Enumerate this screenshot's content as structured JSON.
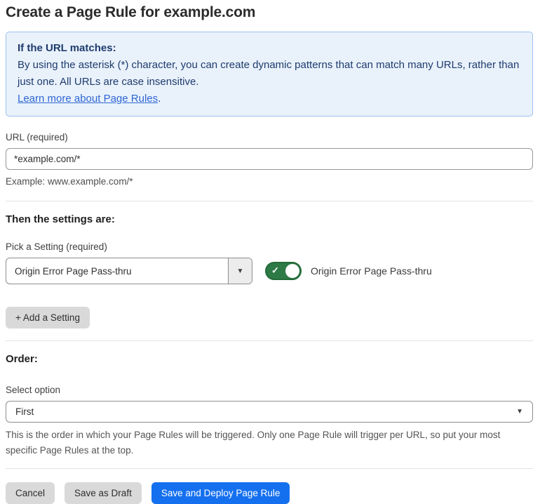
{
  "page": {
    "title": "Create a Page Rule for example.com"
  },
  "callout": {
    "heading": "If the URL matches:",
    "body": "By using the asterisk (*) character, you can create dynamic patterns that can match many URLs, rather than just one. All URLs are case insensitive.",
    "link_label": "Learn more about Page Rules",
    "link_suffix": "."
  },
  "url_section": {
    "label": "URL (required)",
    "input_value": "*example.com/*",
    "helper": "Example: www.example.com/*"
  },
  "settings_section": {
    "heading": "Then the settings are:",
    "picker_label": "Pick a Setting (required)",
    "picker_value": "Origin Error Page Pass-thru",
    "toggle_state": "on",
    "toggle_check": "✓",
    "toggle_label": "Origin Error Page Pass-thru",
    "add_button_label": "+ Add a Setting"
  },
  "order_section": {
    "heading": "Order:",
    "select_label": "Select option",
    "select_value": "First",
    "helper": "This is the order in which your Page Rules will be triggered. Only one Page Rule will trigger per URL, so put your most specific Page Rules at the top."
  },
  "footer": {
    "cancel_label": "Cancel",
    "save_draft_label": "Save as Draft",
    "save_deploy_label": "Save and Deploy Page Rule"
  },
  "icons": {
    "dropdown_caret": "▼",
    "select_caret": "▼"
  },
  "colors": {
    "callout_bg": "#e9f1fb",
    "callout_border": "#9cc2ed",
    "callout_text": "#1e3c6d",
    "link": "#2e67d3",
    "toggle_on": "#2d7a46",
    "primary_button": "#1570ef"
  }
}
